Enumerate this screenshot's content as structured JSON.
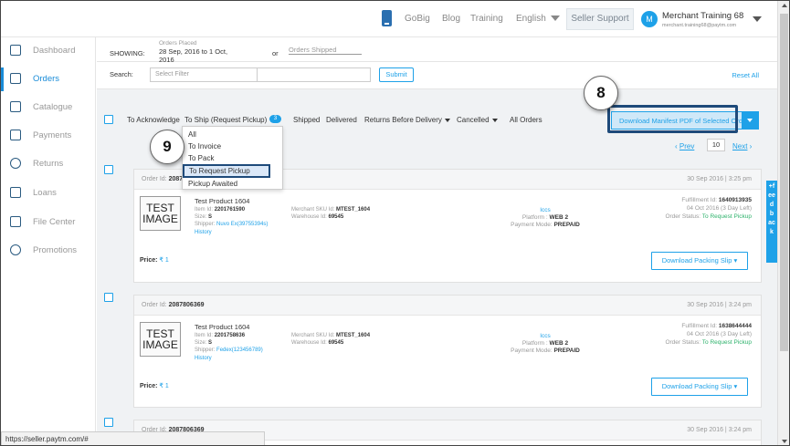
{
  "topbar": {
    "gobig": "GoBig",
    "blog": "Blog",
    "training": "Training",
    "language": "English",
    "seller_support": "Seller Support",
    "avatar_letter": "M",
    "merchant_name": "Merchant Training 68",
    "merchant_email": "merchant.training68@paytm.com"
  },
  "sidebar": {
    "items": [
      {
        "label": "Dashboard",
        "icon": "home-icon"
      },
      {
        "label": "Orders",
        "icon": "orders-icon"
      },
      {
        "label": "Catalogue",
        "icon": "catalogue-icon"
      },
      {
        "label": "Payments",
        "icon": "card-icon"
      },
      {
        "label": "Returns",
        "icon": "returns-icon"
      },
      {
        "label": "Loans",
        "icon": "loans-icon"
      },
      {
        "label": "File Center",
        "icon": "file-icon"
      },
      {
        "label": "Promotions",
        "icon": "promo-icon"
      }
    ]
  },
  "filters": {
    "showing_label": "SHOWING:",
    "orders_placed_label": "Orders Placed",
    "date_range": "28 Sep, 2016 to 1 Oct, 2016",
    "or": "or",
    "orders_shipped": "Orders Shipped",
    "search_label": "Search:",
    "search_placeholder": "Select Filter",
    "submit": "Submit",
    "reset": "Reset All"
  },
  "tabs": {
    "to_acknowledge": "To Acknowledge",
    "to_ship": "To Ship (Request Pickup)",
    "to_ship_count": "3",
    "shipped": "Shipped",
    "delivered": "Delivered",
    "returns_before_delivery": "Returns Before Delivery",
    "cancelled": "Cancelled",
    "all_orders": "All Orders"
  },
  "manifest_button": "Download Manifest PDF of Selected Orders",
  "dropdown": {
    "items": [
      "All",
      "To Invoice",
      "To Pack",
      "To Request Pickup",
      "Pickup Awaited"
    ],
    "selected": "To Request Pickup"
  },
  "callouts": {
    "c8": "8",
    "c9": "9"
  },
  "pager": {
    "prev": "Prev",
    "page": "10",
    "next": "Next"
  },
  "orders": [
    {
      "order_label": "Order Id:",
      "order_id": "2087",
      "date": "30 Sep 2016 | 3:25 pm",
      "image_text": "TEST IMAGE",
      "product": "Test Product 1604",
      "item_id_label": "Item Id:",
      "item_id": "2201761590",
      "size_label": "Size:",
      "size": "S",
      "shipper_label": "Shipper:",
      "shipper": "Nuvo Ex(39755394s)",
      "history": "History",
      "sku_label": "Merchant SKU Id:",
      "sku": "MTEST_1604",
      "warehouse_label": "Warehouse Id:",
      "warehouse": "69545",
      "channel": "Iccs",
      "platform_label": "Platform :",
      "platform": "WEB 2",
      "payment_label": "Payment Mode:",
      "payment": "PREPAID",
      "fulfillment_label": "Fulfillment Id:",
      "fulfillment": "1640913935",
      "due": "04 Oct 2016 (3 Day Left)",
      "status_label": "Order Status:",
      "status": "To Request Pickup",
      "price_label": "Price:",
      "price": "₹ 1",
      "download": "Download Packing Slip"
    },
    {
      "order_label": "Order Id:",
      "order_id": "2087806369",
      "date": "30 Sep 2016 | 3:24 pm",
      "image_text": "TEST IMAGE",
      "product": "Test Product 1604",
      "item_id_label": "Item Id:",
      "item_id": "2201758636",
      "size_label": "Size:",
      "size": "S",
      "shipper_label": "Shipper:",
      "shipper": "Fedex(123456789)",
      "history": "History",
      "sku_label": "Merchant SKU Id:",
      "sku": "MTEST_1604",
      "warehouse_label": "Warehouse Id:",
      "warehouse": "69545",
      "channel": "Iccs",
      "platform_label": "Platform :",
      "platform": "WEB 2",
      "payment_label": "Payment Mode:",
      "payment": "PREPAID",
      "fulfillment_label": "Fulfillment Id:",
      "fulfillment": "1638644444",
      "due": "04 Oct 2016 (3 Day Left)",
      "status_label": "Order Status:",
      "status": "To Request Pickup",
      "price_label": "Price:",
      "price": "₹ 1",
      "download": "Download Packing Slip"
    },
    {
      "order_label": "Order Id:",
      "order_id": "2087806369",
      "date": "30 Sep 2016 | 3:24 pm"
    }
  ],
  "feedback": "+feedback",
  "status_url": "https://seller.paytm.com/#",
  "colors": {
    "accent": "#1ea1e8",
    "highlight": "#1e4a7a",
    "success": "#2db26b"
  }
}
